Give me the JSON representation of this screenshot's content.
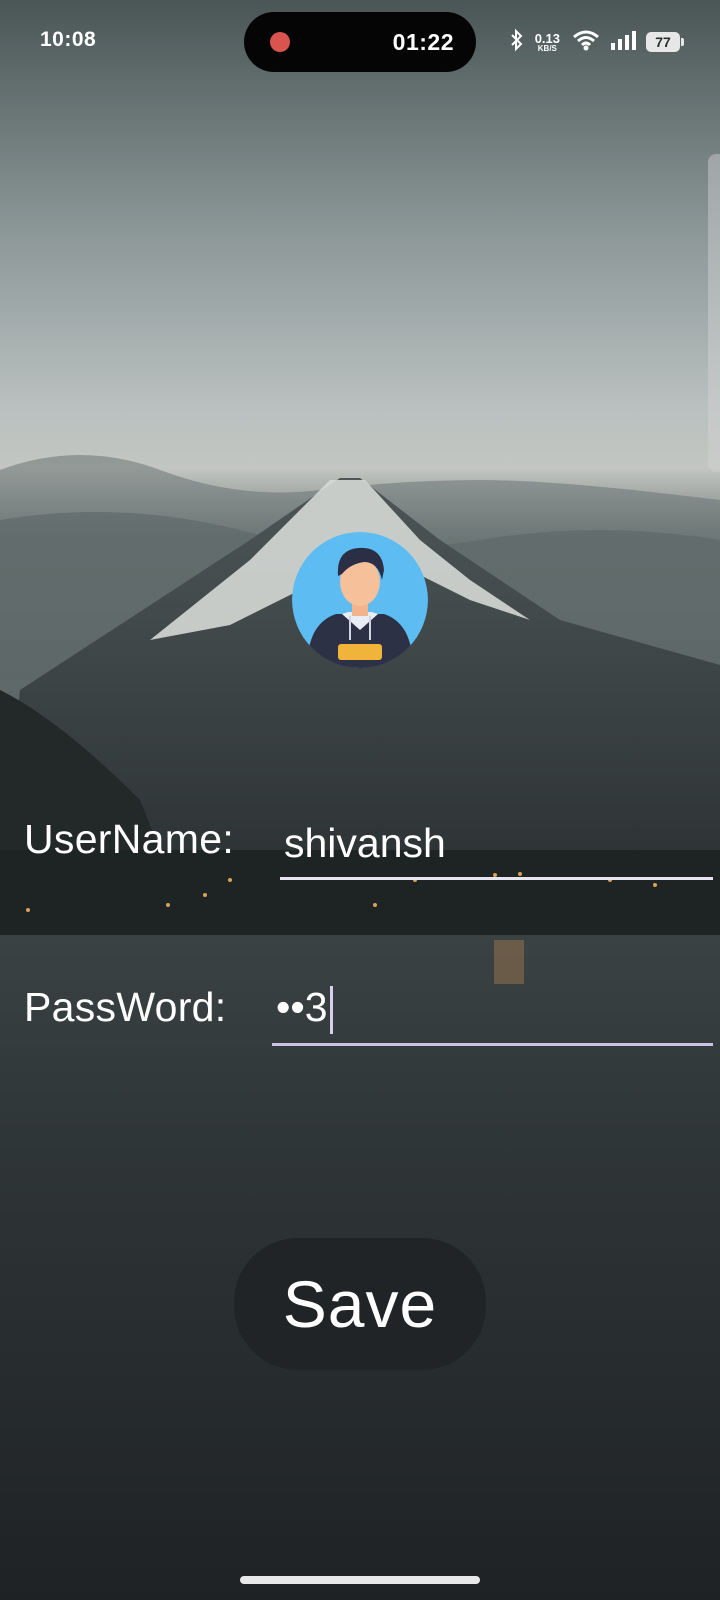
{
  "status_bar": {
    "time": "10:08",
    "recording_time": "01:22",
    "net_speed_value": "0.13",
    "net_speed_unit": "KB/S",
    "battery": "77"
  },
  "form": {
    "username_label": "UserName:",
    "username_value": "shivansh",
    "password_label": "PassWord:",
    "password_value": "••3"
  },
  "save_button": {
    "label": "Save"
  },
  "colors": {
    "record_dot": "#d9534f",
    "avatar_bg": "#5dbcf2",
    "password_underline": "#c9c2e2"
  }
}
